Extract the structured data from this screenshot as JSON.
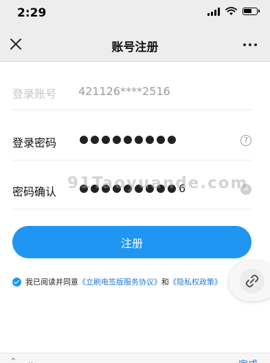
{
  "status": {
    "time": "2:29"
  },
  "nav": {
    "title": "账号注册",
    "close_icon": "close-icon",
    "more_icon": "more-icon"
  },
  "form": {
    "account_label": "登录账号",
    "account_value": "421126****2516",
    "password_label": "登录密码",
    "confirm_label": "密码确认",
    "confirm_suffix": "6",
    "help_icon": "help-icon",
    "clear_icon": "clear-icon"
  },
  "watermark": "91Taoyuande.com",
  "submit": {
    "label": "注册"
  },
  "agreement": {
    "prefix": "我已阅读并同意",
    "terms": "《立刷电签版服务协议》",
    "and": "和",
    "privacy": "《隐私权政策》"
  },
  "bottom": {
    "done": "完成"
  }
}
